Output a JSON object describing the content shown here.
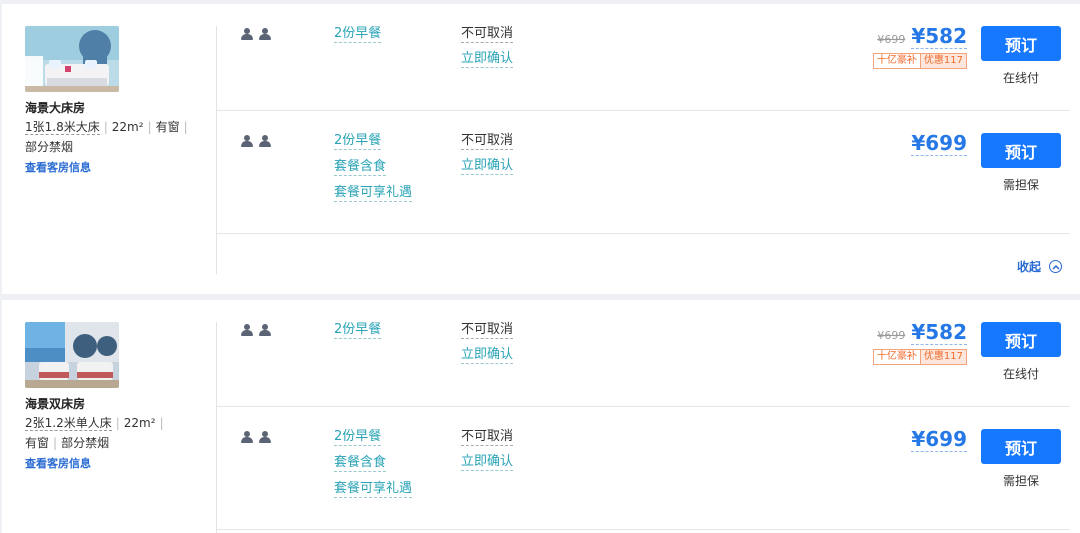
{
  "rooms": [
    {
      "name": "海景大床房",
      "bed": "1张1.8米大床",
      "area": "22m²",
      "window": "有窗",
      "smoking": "部分禁烟",
      "link": "查看客房信息",
      "photo_icon": "room-photo-bedroom",
      "rates": [
        {
          "guest_icon": "person-icon",
          "meals": [
            "2份早餐"
          ],
          "cancel": "不可取消",
          "confirm": "立即确认",
          "old_price": "¥699",
          "price": "¥582",
          "tag_a": "十亿豪补",
          "tag_b": "优惠117",
          "book": "预订",
          "pay": "在线付"
        },
        {
          "guest_icon": "person-icon",
          "meals": [
            "2份早餐",
            "套餐含食",
            "套餐可享礼遇"
          ],
          "cancel": "不可取消",
          "confirm": "立即确认",
          "price": "¥699",
          "book": "预订",
          "pay": "需担保"
        }
      ],
      "collapse": "收起"
    },
    {
      "name": "海景双床房",
      "bed": "2张1.2米单人床",
      "area": "22m²",
      "window": "有窗",
      "smoking": "部分禁烟",
      "link": "查看客房信息",
      "photo_icon": "room-photo-twin",
      "rates": [
        {
          "guest_icon": "person-icon",
          "meals": [
            "2份早餐"
          ],
          "cancel": "不可取消",
          "confirm": "立即确认",
          "old_price": "¥699",
          "price": "¥582",
          "tag_a": "十亿豪补",
          "tag_b": "优惠117",
          "book": "预订",
          "pay": "在线付"
        },
        {
          "guest_icon": "person-icon",
          "meals": [
            "2份早餐",
            "套餐含食",
            "套餐可享礼遇"
          ],
          "cancel": "不可取消",
          "confirm": "立即确认",
          "price": "¥699",
          "book": "预订",
          "pay": "需担保"
        }
      ]
    }
  ],
  "colors": {
    "price_blue": "#2678e6",
    "button_blue": "#1677ff",
    "link_teal": "#29a3b6",
    "promo_orange": "#f06a2a"
  }
}
